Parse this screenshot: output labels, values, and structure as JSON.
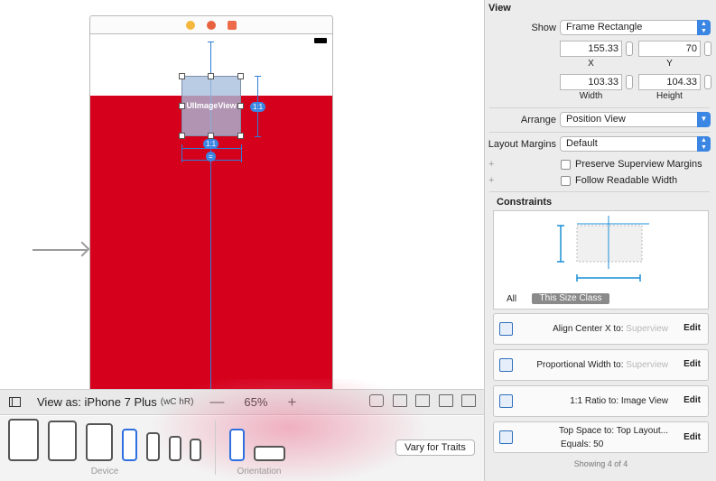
{
  "canvas": {
    "image_view_label": "UIImageView",
    "badge_width": "1:1",
    "badge_ratio": "1:1",
    "badge_equal": "="
  },
  "view_as_bar": {
    "label": "View as: iPhone 7 Plus",
    "size_class": "(wC hR)",
    "zoom_out": "—",
    "zoom": "65%",
    "zoom_in": "+"
  },
  "device_bar": {
    "device_caption": "Device",
    "orientation_caption": "Orientation",
    "vary_button": "Vary for Traits"
  },
  "inspector": {
    "title": "View",
    "show": {
      "label": "Show",
      "value": "Frame Rectangle"
    },
    "frame": {
      "x": "155.33",
      "y": "70",
      "width": "103.33",
      "height": "104.33",
      "x_label": "X",
      "y_label": "Y",
      "width_label": "Width",
      "height_label": "Height"
    },
    "arrange": {
      "label": "Arrange",
      "value": "Position View"
    },
    "layout_margins": {
      "label": "Layout Margins",
      "value": "Default"
    },
    "plus": "+",
    "preserve_margins": "Preserve Superview Margins",
    "follow_readable": "Follow Readable Width",
    "constraints_title": "Constraints",
    "segment_all": "All",
    "segment_size_class": "This Size Class",
    "constraints": [
      {
        "label": "Align Center X to:",
        "target": "Superview",
        "edit": "Edit"
      },
      {
        "label": "Proportional Width to:",
        "target": "Superview",
        "edit": "Edit"
      },
      {
        "label": "1:1 Ratio to:",
        "target": "Image View",
        "edit": "Edit"
      },
      {
        "label": "Top Space to:",
        "target": "Top Layout...",
        "equals": "Equals:",
        "equals_value": "50",
        "edit": "Edit"
      }
    ],
    "showing": "Showing 4 of 4"
  },
  "colors": {
    "red_view": "#d5001c",
    "accent": "#3c86e3",
    "constraint_line": "#2f7ed8"
  }
}
